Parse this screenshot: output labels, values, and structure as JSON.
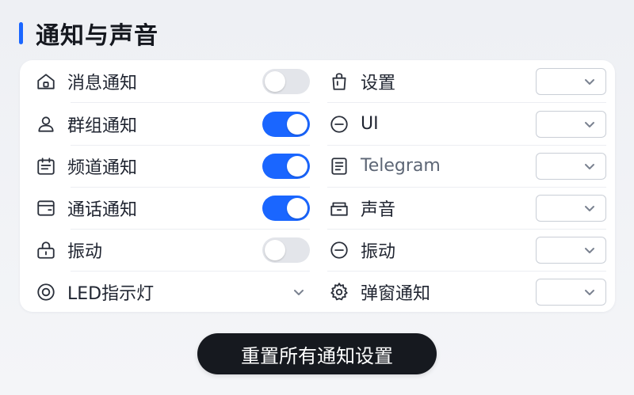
{
  "page_title": "通知与声音",
  "accent_color": "#1a66ff",
  "left_rows": [
    {
      "label": "消息通知",
      "icon": "home-icon",
      "control": "toggle",
      "checked": false
    },
    {
      "label": "群组通知",
      "icon": "user-icon",
      "control": "toggle",
      "checked": true
    },
    {
      "label": "频道通知",
      "icon": "calendar-icon",
      "control": "toggle",
      "checked": true
    },
    {
      "label": "通话通知",
      "icon": "wallet-icon",
      "control": "toggle",
      "checked": true
    },
    {
      "label": "振动",
      "icon": "lock-icon",
      "control": "toggle",
      "checked": false
    },
    {
      "label": "LED指示灯",
      "icon": "target-icon",
      "control": "dropdown"
    }
  ],
  "right_rows": [
    {
      "label": "设置",
      "icon": "bag-icon",
      "control": "select",
      "value": ""
    },
    {
      "label": "UI",
      "icon": "minus-circle-icon",
      "control": "select",
      "value": ""
    },
    {
      "label": "Telegram",
      "icon": "document-icon",
      "control": "select",
      "value": ""
    },
    {
      "label": "声音",
      "icon": "inbox-icon",
      "control": "select",
      "value": ""
    },
    {
      "label": "振动",
      "icon": "minus-circle-icon",
      "control": "select",
      "value": ""
    },
    {
      "label": "弹窗通知",
      "icon": "gear-icon",
      "control": "select",
      "value": ""
    }
  ],
  "reset_button": "重置所有通知设置"
}
